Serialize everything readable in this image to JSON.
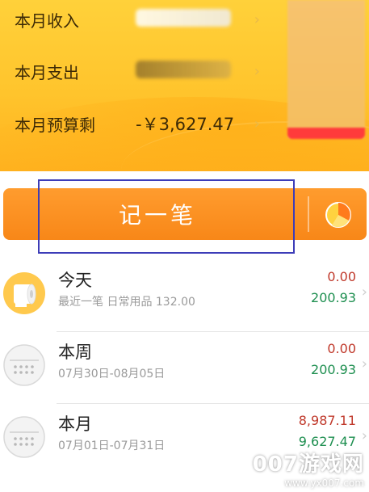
{
  "summary": {
    "income_label": "本月收入",
    "expense_label": "本月支出",
    "budget_label": "本月预算剩",
    "budget_value": "-￥3,627.47"
  },
  "record": {
    "label": "记一笔"
  },
  "periods": [
    {
      "title": "今天",
      "subtitle": "最近一笔 日常用品 132.00",
      "top_amount": "0.00",
      "bottom_amount": "200.93",
      "icon": "toilet-paper-icon"
    },
    {
      "title": "本周",
      "subtitle": "07月30日-08月05日",
      "top_amount": "0.00",
      "bottom_amount": "200.93",
      "icon": "calendar-icon"
    },
    {
      "title": "本月",
      "subtitle": "07月01日-07月31日",
      "top_amount": "8,987.11",
      "bottom_amount": "9,627.47",
      "icon": "calendar-icon"
    }
  ],
  "watermark": {
    "title": "007游戏网",
    "url": "www.yx007.com"
  },
  "colors": {
    "header": "#ffc42c",
    "record_button": "#f88718",
    "expense_amount": "#c0392b",
    "income_amount": "#1e8f50",
    "budget_alert": "#ff3b3b"
  }
}
